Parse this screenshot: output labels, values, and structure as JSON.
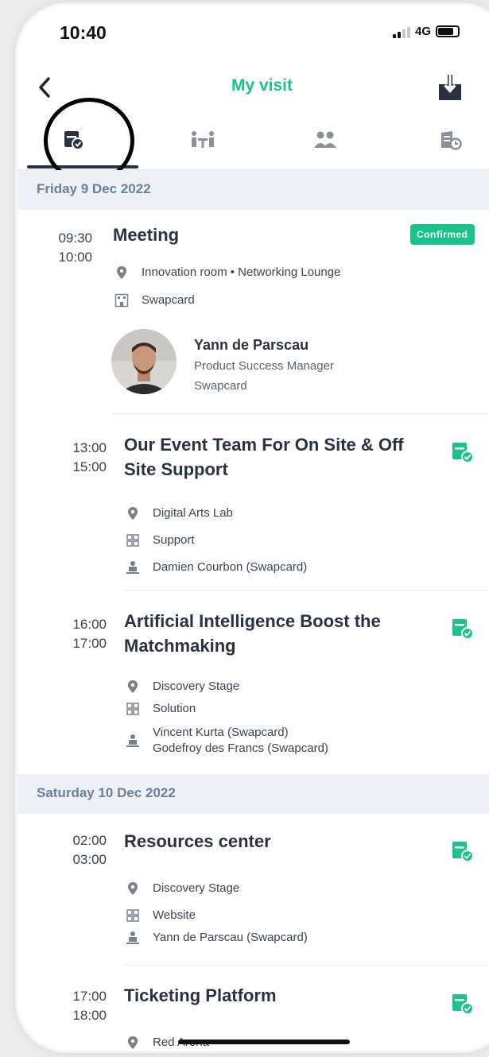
{
  "status_bar": {
    "time": "10:40",
    "network": "4G"
  },
  "header": {
    "title": "My visit"
  },
  "tabs": [
    "calendar-check-icon",
    "people-table-icon",
    "group-icon",
    "booth-icon"
  ],
  "days": [
    {
      "label": "Friday 9 Dec 2022"
    },
    {
      "label": "Saturday 10 Dec 2022"
    }
  ],
  "meeting": {
    "start": "09:30",
    "end": "10:00",
    "title": "Meeting",
    "status": "Confirmed",
    "location": "Innovation room • Networking Lounge",
    "organization": "Swapcard",
    "person": {
      "name": "Yann de Parscau",
      "role": "Product Success Manager",
      "company": "Swapcard"
    }
  },
  "sessions": [
    {
      "start": "13:00",
      "end": "15:00",
      "title_lines": [
        "Our Event Team For On Site & Off",
        "Site Support"
      ],
      "location": "Digital Arts Lab",
      "category": "Support",
      "speakers": [
        "Damien Courbon (Swapcard)"
      ]
    },
    {
      "start": "16:00",
      "end": "17:00",
      "title_lines": [
        "Artificial Intelligence Boost the",
        "Matchmaking"
      ],
      "location": "Discovery Stage",
      "category": "Solution",
      "speakers": [
        "Vincent Kurta (Swapcard)",
        "Godefroy des Francs (Swapcard)"
      ]
    },
    {
      "start": "02:00",
      "end": "03:00",
      "title_lines": [
        "Resources center"
      ],
      "location": "Discovery Stage",
      "category": "Website",
      "speakers": [
        "Yann de Parscau (Swapcard)"
      ]
    },
    {
      "start": "17:00",
      "end": "18:00",
      "title_lines": [
        "Ticketing Platform"
      ],
      "location": "Red Arena"
    }
  ],
  "colors": {
    "accent": "#19c38a",
    "text": "#2a3140",
    "band": "#edf0f4",
    "band_text": "#6b7f97"
  }
}
